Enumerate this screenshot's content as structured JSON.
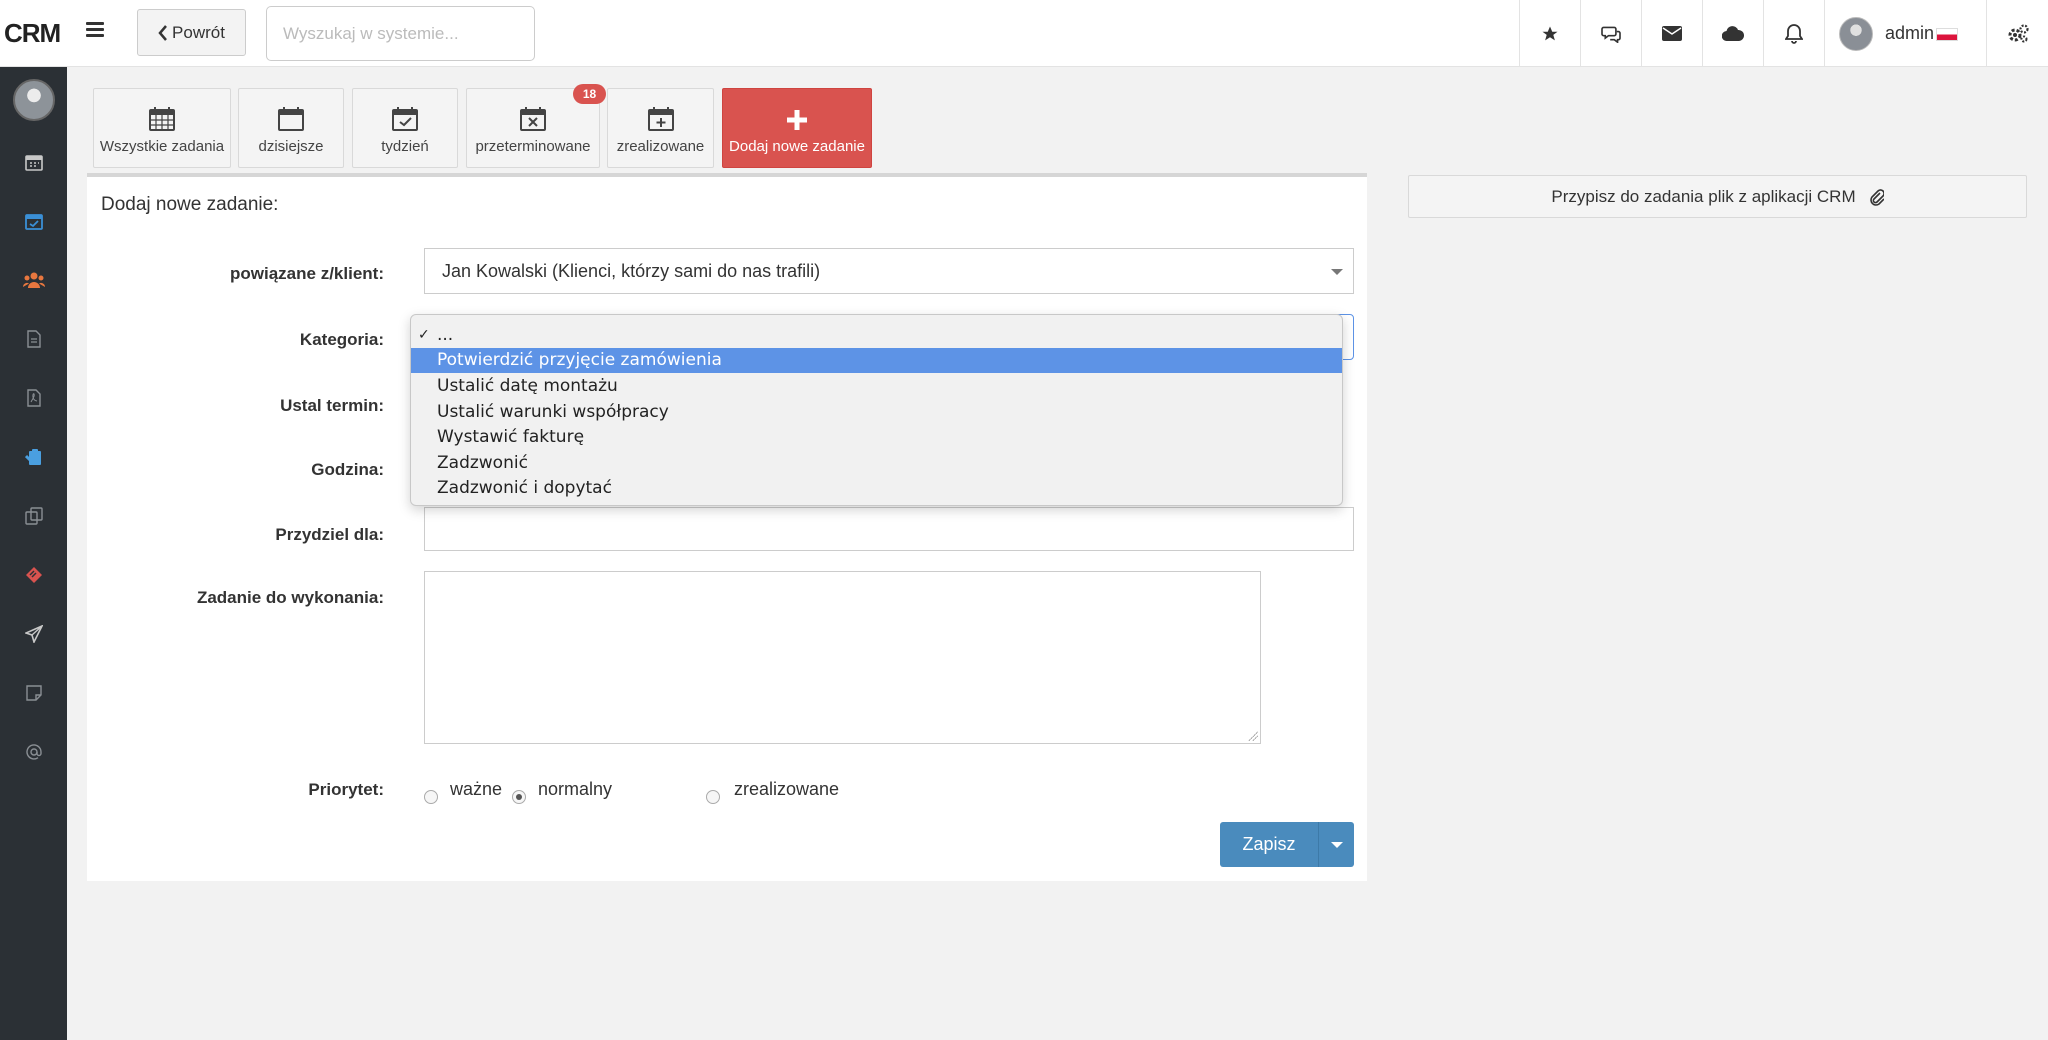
{
  "app": {
    "brand": "CRM"
  },
  "header": {
    "back_label": "Powrót",
    "search_placeholder": "Wyszukaj w systemie...",
    "user_name": "admin",
    "icons": [
      "star-icon",
      "comments-icon",
      "envelope-icon",
      "cloud-icon",
      "bell-icon",
      "gears-icon"
    ]
  },
  "sidebar": {
    "items": [
      "calendar-icon",
      "calendar-check-icon",
      "users-icon",
      "file-icon",
      "file-pdf-icon",
      "clipboard-icon",
      "copy-icon",
      "ticket-icon",
      "paper-plane-icon",
      "note-icon",
      "at-icon"
    ],
    "accent": "#3a8fd6"
  },
  "toolbar": {
    "tiles": [
      {
        "label": "Wszystkie zadania",
        "icon": "calendar-grid-icon"
      },
      {
        "label": "dzisiejsze",
        "icon": "calendar-icon"
      },
      {
        "label": "tydzień",
        "icon": "calendar-check-icon"
      },
      {
        "label": "przeterminowane",
        "icon": "calendar-times-icon",
        "badge": "18"
      },
      {
        "label": "zrealizowane",
        "icon": "calendar-plus-icon"
      },
      {
        "label": "Dodaj nowe zadanie",
        "icon": "plus-icon"
      }
    ],
    "primary_color": "#d9534f"
  },
  "form": {
    "title": "Dodaj nowe zadanie:",
    "labels": {
      "client": "powiązane z/klient:",
      "category": "Kategoria:",
      "deadline": "Ustal termin:",
      "time": "Godzina:",
      "assign": "Przydziel dla:",
      "task": "Zadanie do wykonania:",
      "priority": "Priorytet:"
    },
    "client_value": "Jan Kowalski (Klienci, którzy sami do nas trafili)",
    "priority_options": [
      "ważne",
      "normalny",
      "zrealizowane"
    ],
    "priority_selected": "normalny",
    "save_label": "Zapisz",
    "save_color": "#4a8bbd"
  },
  "category_dropdown": {
    "options": [
      "...",
      "Potwierdzić przyjęcie zamówienia",
      "Ustalić datę montażu",
      "Ustalić warunki współpracy",
      "Wystawić fakturę",
      "Zadzwonić",
      "Zadzwonić i dopytać"
    ],
    "checked": "...",
    "highlighted": "Potwierdzić przyjęcie zamówienia",
    "highlight_color": "#5d93e6"
  },
  "attach": {
    "label": "Przypisz do zadania plik z aplikacji CRM",
    "icon": "paperclip-icon"
  }
}
